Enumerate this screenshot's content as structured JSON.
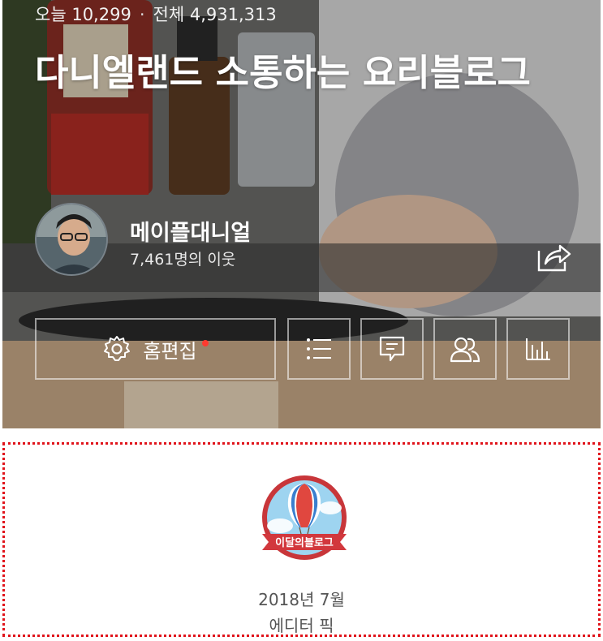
{
  "stats": {
    "today_label": "오늘",
    "today_count": "10,299",
    "separator": "·",
    "total_label": "전체",
    "total_count": "4,931,313"
  },
  "blog": {
    "title": "다니엘랜드 소통하는 요리블로그"
  },
  "profile": {
    "nickname": "메이플대니얼",
    "neighbors": "7,461명의 이웃"
  },
  "actions": {
    "edit_label": "홈편집",
    "icons": [
      "gear-icon",
      "list-icon",
      "comment-icon",
      "neighbors-icon",
      "stats-icon",
      "share-icon"
    ]
  },
  "award": {
    "badge_text": "이달의블로그",
    "date": "2018년 7월",
    "pick": "에디터 픽"
  },
  "colors": {
    "accent_red": "#e0141b",
    "notification_dot": "#ff3a2f",
    "badge_blue": "#7fc4ea",
    "ribbon_red": "#c8363a"
  }
}
